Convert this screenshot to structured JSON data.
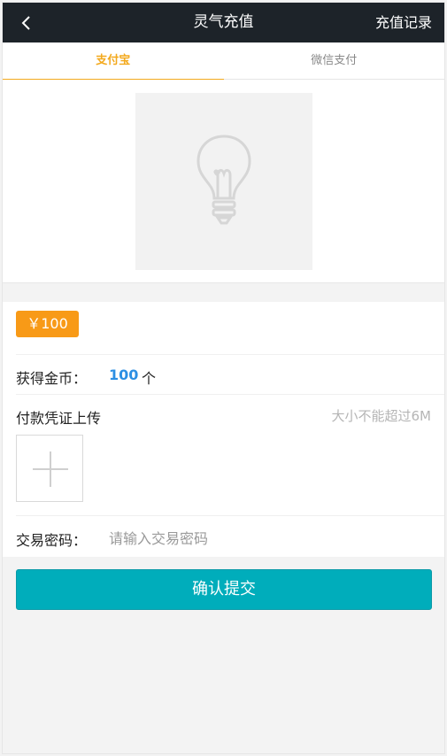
{
  "header": {
    "title": "灵气充值",
    "right_link": "充值记录",
    "back_icon": "chevron-left-icon"
  },
  "tabs": [
    {
      "label": "支付宝",
      "active": true
    },
    {
      "label": "微信支付",
      "active": false
    }
  ],
  "qr": {
    "placeholder_icon": "lightbulb-icon"
  },
  "form": {
    "amount": "￥100",
    "coins_label": "获得金币：",
    "coins_value": "100",
    "coins_unit": "个",
    "upload_label": "付款凭证上传",
    "upload_hint": "大小不能超过6M",
    "upload_icon": "plus-icon",
    "password_label": "交易密码：",
    "password_placeholder": "请输入交易密码",
    "password_value": ""
  },
  "submit": {
    "label": "确认提交"
  },
  "colors": {
    "header_bg": "#1d2329",
    "tab_active": "#f3a91d",
    "amount_chip": "#f89a17",
    "coins_value": "#2c8fe3",
    "submit_bg": "#00adbb"
  }
}
